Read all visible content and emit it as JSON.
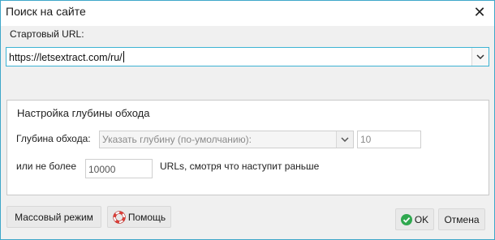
{
  "window": {
    "title": "Поиск на сайте",
    "close_icon": "close-icon"
  },
  "start_url": {
    "label": "Стартовый URL:",
    "value": "https://letsextract.com/ru/"
  },
  "depth_group": {
    "title": "Настройка глубины обхода",
    "depth_label": "Глубина обхода:",
    "depth_select_value": "Указать глубину (по-умолчанию):",
    "depth_value": "10",
    "limit_label": "или не более",
    "limit_value": "10000",
    "limit_suffix": "URLs, смотря что наступит раньше"
  },
  "buttons": {
    "bulk_mode": "Массовый режим",
    "help": "Помощь",
    "ok": "OK",
    "cancel": "Отмена"
  },
  "colors": {
    "accent_border": "#3db3d3",
    "ok_icon": "#2fa84f",
    "help_icon": "#e0403a"
  }
}
